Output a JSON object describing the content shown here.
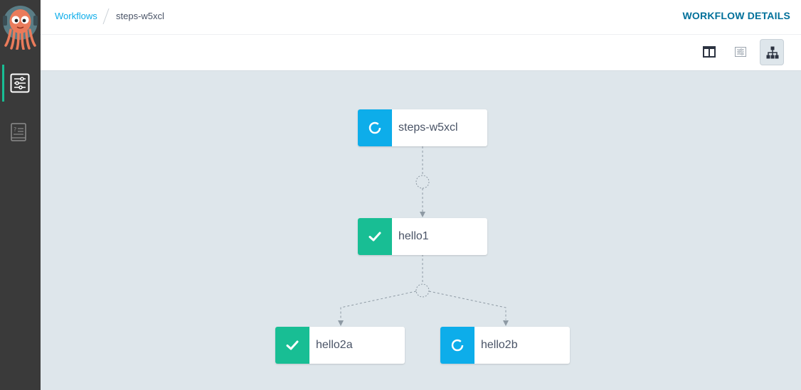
{
  "app": {
    "name": "Argo Workflows",
    "brand_color": "#0dadea"
  },
  "sidebar": {
    "items": [
      {
        "icon": "workflows-icon",
        "active": true
      },
      {
        "icon": "help-book-icon",
        "active": false
      }
    ]
  },
  "header": {
    "breadcrumb": {
      "parent": "Workflows",
      "current": "steps-w5xcl"
    },
    "title": "WORKFLOW DETAILS"
  },
  "toolbar": {
    "buttons": [
      {
        "icon": "split-view-icon",
        "active": false
      },
      {
        "icon": "list-view-icon",
        "active": false
      },
      {
        "icon": "tree-view-icon",
        "active": true
      }
    ]
  },
  "graph": {
    "nodes": [
      {
        "label": "steps-w5xcl",
        "status": "running"
      },
      {
        "label": "hello1",
        "status": "succeeded"
      },
      {
        "label": "hello2a",
        "status": "succeeded"
      },
      {
        "label": "hello2b",
        "status": "running"
      }
    ]
  },
  "colors": {
    "running": "#0dadea",
    "succeeded": "#18be94",
    "sidebar": "#3a3a3a",
    "title": "#00709a"
  }
}
